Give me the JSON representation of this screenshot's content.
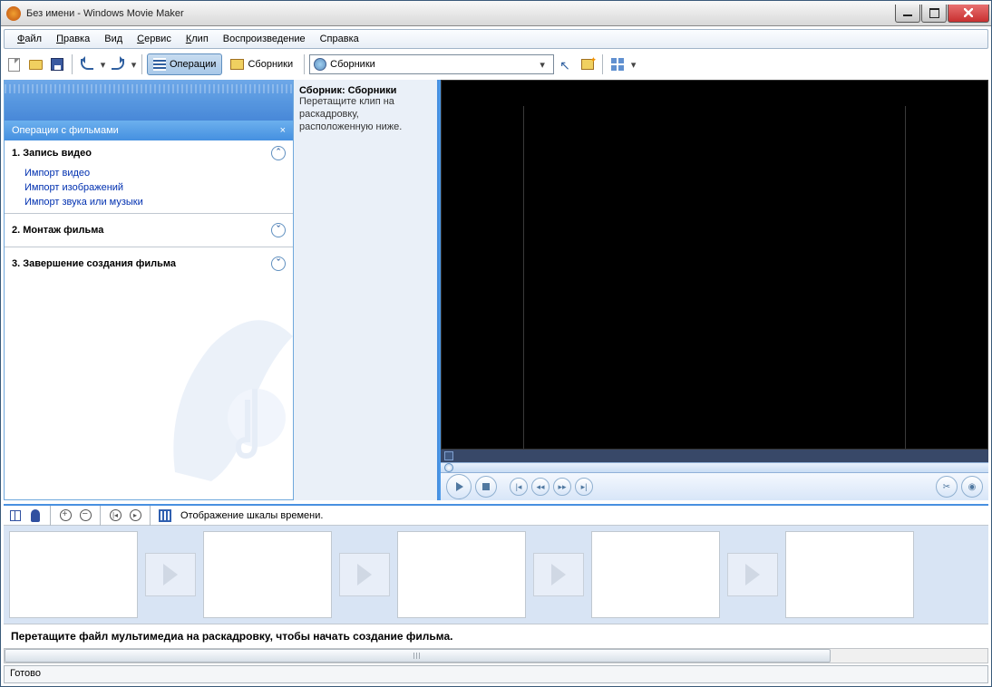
{
  "window": {
    "title": "Без имени - Windows Movie Maker"
  },
  "menu": {
    "file": "Файл",
    "edit": "Правка",
    "view": "Вид",
    "service": "Сервис",
    "clip": "Клип",
    "play": "Воспроизведение",
    "help": "Справка"
  },
  "toolbar": {
    "tasks_label": "Операции",
    "collections_label": "Сборники",
    "combo_value": "Сборники"
  },
  "tasks": {
    "panel_title": "Операции с фильмами",
    "sections": [
      {
        "title": "1. Запись видео",
        "links": [
          "Импорт видео",
          "Импорт изображений",
          "Импорт звука или музыки"
        ]
      },
      {
        "title": "2. Монтаж фильма"
      },
      {
        "title": "3. Завершение создания фильма"
      }
    ]
  },
  "collection": {
    "heading_prefix": "Сборник: ",
    "heading_name": "Сборники",
    "hint": "Перетащите клип на раскадровку, расположенную ниже."
  },
  "timeline": {
    "toggle_label": "Отображение шкалы времени.",
    "drop_hint": "Перетащите файл мультимедиа на раскадровку, чтобы начать создание фильма."
  },
  "status": {
    "text": "Готово"
  }
}
